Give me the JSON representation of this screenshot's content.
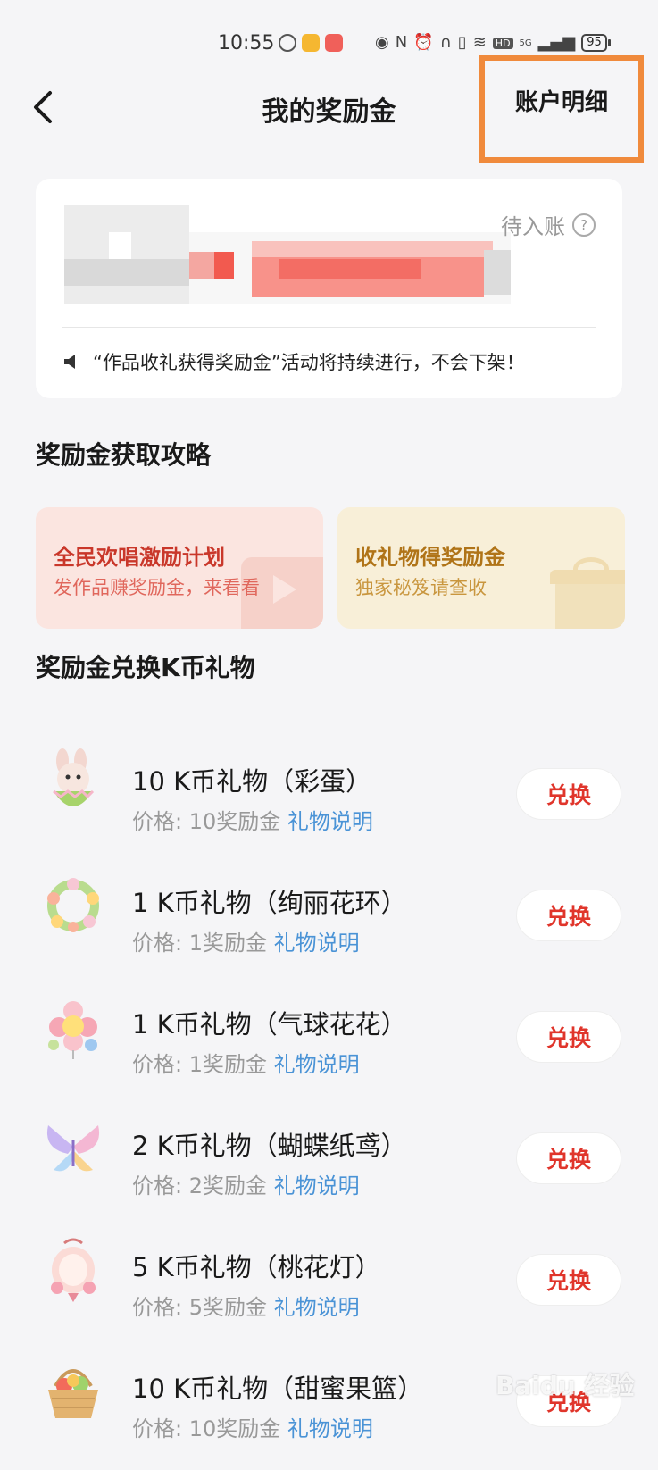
{
  "status_bar": {
    "time": "10:55",
    "battery": "95",
    "network": "5G"
  },
  "navbar": {
    "title": "我的奖励金",
    "detail_label": "账户明细"
  },
  "balance_card": {
    "pending_label": "待入账",
    "notice": "“作品收礼获得奖励金”活动将持续进行，不会下架！"
  },
  "strategy": {
    "title": "奖励金获取攻略",
    "cards": [
      {
        "title": "全民欢唱激励计划",
        "subtitle": "发作品赚奖励金，来看看"
      },
      {
        "title": "收礼物得奖励金",
        "subtitle": "独家秘笈请查收"
      }
    ]
  },
  "exchange": {
    "title": "奖励金兑换K币礼物",
    "button_label": "兑换",
    "link_label": "礼物说明",
    "items": [
      {
        "name": "10 K币礼物（彩蛋）",
        "price": "价格: 10奖励金",
        "icon": "bunny-egg-icon"
      },
      {
        "name": "1 K币礼物（绚丽花环）",
        "price": "价格: 1奖励金",
        "icon": "flower-wreath-icon"
      },
      {
        "name": "1 K币礼物（气球花花）",
        "price": "价格: 1奖励金",
        "icon": "balloon-flower-icon"
      },
      {
        "name": "2 K币礼物（蝴蝶纸鸢）",
        "price": "价格: 2奖励金",
        "icon": "butterfly-kite-icon"
      },
      {
        "name": "5 K币礼物（桃花灯）",
        "price": "价格: 5奖励金",
        "icon": "peach-lantern-icon"
      },
      {
        "name": "10 K币礼物（甜蜜果篮）",
        "price": "价格: 10奖励金",
        "icon": "fruit-basket-icon"
      }
    ]
  },
  "colors": {
    "accent_red": "#e0352b",
    "link_blue": "#4a93d6",
    "highlight_orange": "#f08a3c"
  },
  "watermark": "Baidu 经验"
}
